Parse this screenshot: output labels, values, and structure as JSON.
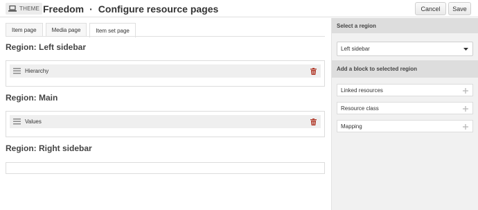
{
  "header": {
    "theme_label": "THEME",
    "site_name": "Freedom",
    "separator": "·",
    "page_name": "Configure resource pages",
    "cancel_label": "Cancel",
    "save_label": "Save"
  },
  "tabs": [
    {
      "label": "Item page",
      "active": false
    },
    {
      "label": "Media page",
      "active": false
    },
    {
      "label": "Item set page",
      "active": true
    }
  ],
  "regions": [
    {
      "title": "Region: Left sidebar",
      "blocks": [
        {
          "label": "Hierarchy"
        }
      ]
    },
    {
      "title": "Region: Main",
      "blocks": [
        {
          "label": "Values"
        }
      ]
    },
    {
      "title": "Region: Right sidebar",
      "blocks": []
    }
  ],
  "sidebar": {
    "select_region_heading": "Select a region",
    "selected_region": "Left sidebar",
    "add_block_heading": "Add a block to selected region",
    "available_blocks": [
      {
        "label": "Linked resources"
      },
      {
        "label": "Resource class"
      },
      {
        "label": "Mapping"
      }
    ]
  },
  "colors": {
    "trash": "#b13a2a",
    "sidebar_bg": "#f1f1f1",
    "section_head_bg": "#dddddd"
  },
  "icons": {
    "theme": "laptop-icon",
    "drag": "drag-handle-icon",
    "delete": "trash-icon",
    "select": "caret-down-icon",
    "add": "plus-icon"
  }
}
